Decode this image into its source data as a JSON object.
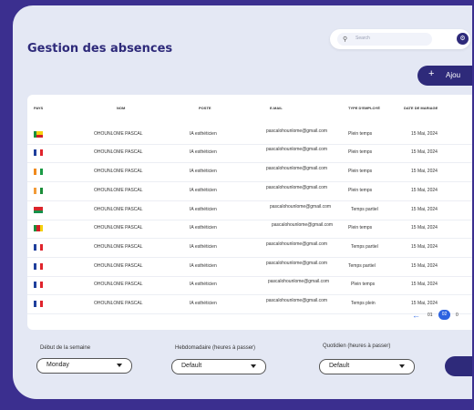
{
  "page": {
    "title": "Gestion des absences"
  },
  "search": {
    "placeholder": "Search"
  },
  "actions": {
    "add_label": "Ajou"
  },
  "table": {
    "headers": [
      "PAYS",
      "NOM",
      "POSTE",
      "E-MAIL",
      "TYPE D'EMPLOYÉ",
      "DATE DE MARIAGE"
    ],
    "rows": [
      {
        "flag": "benin",
        "nom": "OHOUNLOME PASCAL",
        "poste": "IA esthéticien",
        "email": "pascalohounlome@gmail.com",
        "type": "Plein temps",
        "date": "15 Mai, 2024"
      },
      {
        "flag": "france",
        "nom": "OHOUNLOME PASCAL",
        "poste": "IA esthéticien",
        "email": "pascalohounlome@gmail.com",
        "type": "Plein temps",
        "date": "15 Mai, 2024"
      },
      {
        "flag": "ivory-coast",
        "nom": "OHOUNLOME PASCAL",
        "poste": "IA esthéticien",
        "email": "pascalohounlome@gmail.com",
        "type": "Plein temps",
        "date": "15 Mai, 2024"
      },
      {
        "flag": "india",
        "nom": "OHOUNLOME PASCAL",
        "poste": "IA esthéticien",
        "email": "pascalohounlome@gmail.com",
        "type": "Plein temps",
        "date": "15 Mai, 2024"
      },
      {
        "flag": "burkina-faso",
        "nom": "OHOUNLOME PASCAL",
        "poste": "IA esthéticien",
        "email": "pascalohounlome@gmail.com",
        "type": "Temps partiel",
        "date": "15 Mai, 2024"
      },
      {
        "flag": "cameroon",
        "nom": "OHOUNLOME PASCAL",
        "poste": "IA esthéticien",
        "email": "pascalohounlome@gmail.com",
        "type": "Plein temps",
        "date": "15 Mai, 2024"
      },
      {
        "flag": "france",
        "nom": "OHOUNLOME PASCAL",
        "poste": "IA esthéticien",
        "email": "pascalohounlome@gmail.com",
        "type": "Temps partiel",
        "date": "15 Mai, 2024"
      },
      {
        "flag": "france",
        "nom": "OHOUNLOME PASCAL",
        "poste": "IA esthéticien",
        "email": "pascalohounlome@gmail.com",
        "type": "Temps partiel",
        "date": "15 Mai, 2024"
      },
      {
        "flag": "france",
        "nom": "OHOUNLOME PASCAL",
        "poste": "IA esthéticien",
        "email": "pascalohounlome@gmail.com",
        "type": "Plein temps",
        "date": "15 Mai, 2024"
      },
      {
        "flag": "france",
        "nom": "OHOUNLOME PASCAL",
        "poste": "IA esthéticien",
        "email": "pascalohounlome@gmail.com",
        "type": "Temps plein",
        "date": "15 Mai, 2024"
      }
    ]
  },
  "pagination": {
    "prev_icon": "arrow-left-icon",
    "pages": [
      "01",
      "02"
    ],
    "current": "02",
    "next": "0"
  },
  "filters": {
    "week_start": {
      "label": "Début de la semaine",
      "value": "Monday"
    },
    "weekly": {
      "label": "Hebdomadaire (heures à passer)",
      "value": "Default"
    },
    "daily": {
      "label": "Quotidien (heures à passer)",
      "value": "Default"
    }
  },
  "colors": {
    "primary": "#2e2a7a",
    "accent": "#2d63e0",
    "background": "#e4e8f4"
  }
}
